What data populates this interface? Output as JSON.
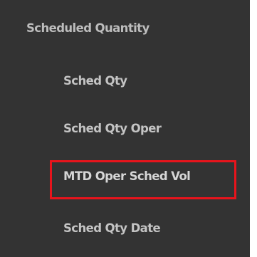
{
  "menu": {
    "section_title": "Scheduled Quantity",
    "items": [
      {
        "label": "Sched Qty"
      },
      {
        "label": "Sched Qty Oper"
      },
      {
        "label": "MTD Oper Sched Vol",
        "highlighted": true
      },
      {
        "label": "Sched Qty Date"
      }
    ]
  },
  "colors": {
    "panel_background": "#333333",
    "text": "#c4c4c4",
    "highlight_border": "#e8141c"
  }
}
